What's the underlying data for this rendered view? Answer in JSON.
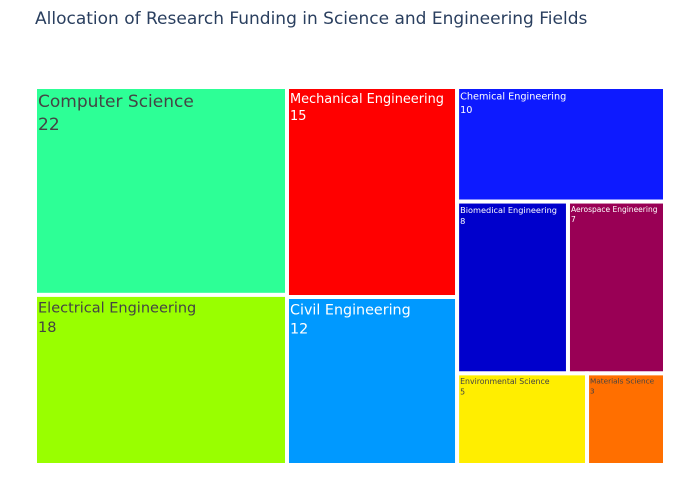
{
  "chart_data": {
    "type": "treemap",
    "title": "Allocation of Research Funding in Science and Engineering Fields",
    "categories": [
      "Computer Science",
      "Electrical Engineering",
      "Mechanical Engineering",
      "Civil Engineering",
      "Chemical Engineering",
      "Biomedical Engineering",
      "Aerospace Engineering",
      "Environmental Science",
      "Materials Science"
    ],
    "values": [
      22,
      18,
      15,
      12,
      10,
      8,
      7,
      5,
      3
    ],
    "colors": [
      "#2dff96",
      "#99ff00",
      "#ff0000",
      "#0099ff",
      "#0d1aff",
      "#0000cc",
      "#990055",
      "#ffee00",
      "#ff6f00"
    ],
    "label_colors": [
      "#444444",
      "#444444",
      "#ffffff",
      "#ffffff",
      "#ffffff",
      "#ffffff",
      "#ffffff",
      "#444444",
      "#444444"
    ]
  }
}
